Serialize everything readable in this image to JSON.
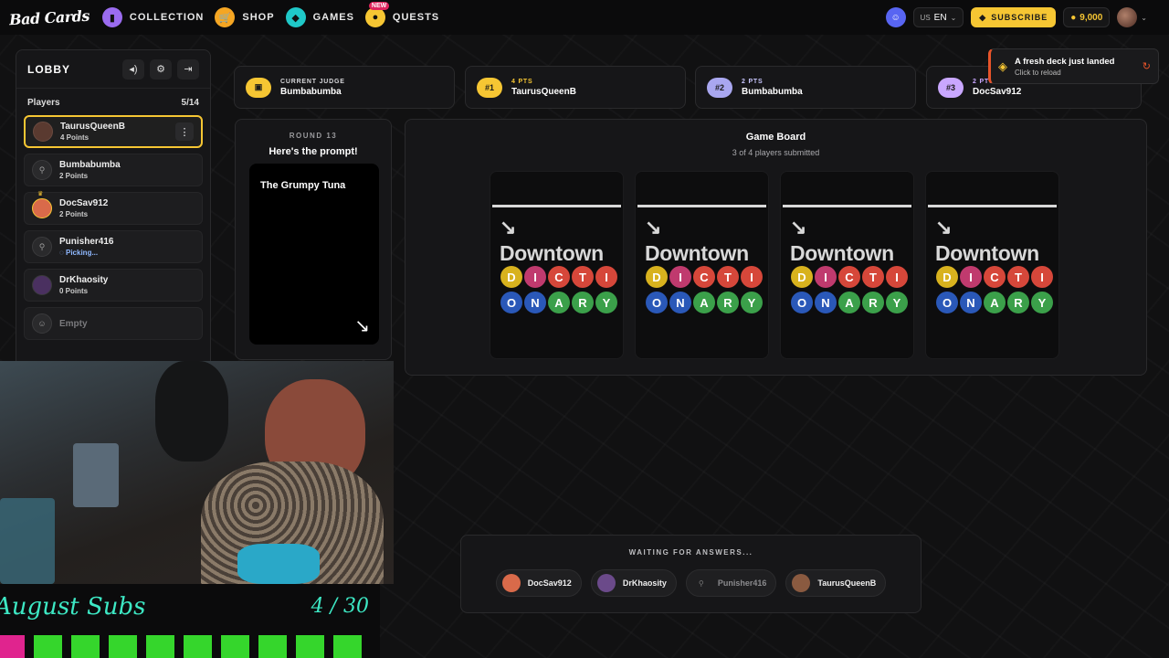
{
  "nav": {
    "logo": "Bad Cards",
    "items": [
      {
        "label": "COLLECTION",
        "color": "#9b6cf0",
        "icon": "card-icon"
      },
      {
        "label": "SHOP",
        "color": "#f5a623",
        "icon": "cart-icon"
      },
      {
        "label": "GAMES",
        "color": "#1fc8c8",
        "icon": "games-icon"
      },
      {
        "label": "QUESTS",
        "color": "#f6c633",
        "icon": "quests-icon",
        "badge": "NEW"
      }
    ],
    "lang_country": "US",
    "lang_code": "EN",
    "subscribe_label": "SUBSCRIBE",
    "coins": "9,000"
  },
  "lobby": {
    "title": "LOBBY",
    "players_label": "Players",
    "players_count": "5/14",
    "players": [
      {
        "name": "TaurusQueenB",
        "points": "4 Points",
        "active": true
      },
      {
        "name": "Bumbabumba",
        "points": "2 Points"
      },
      {
        "name": "DocSav912",
        "points": "2 Points",
        "crown": true
      },
      {
        "name": "Punisher416",
        "status": "Picking..."
      },
      {
        "name": "DrKhaosity",
        "points": "0 Points"
      }
    ],
    "empty_label": "Empty"
  },
  "scoreboard": [
    {
      "badge": "",
      "sub": "CURRENT JUDGE",
      "name": "Bumbabumba",
      "color": "#f6c633",
      "sub_color": "#d7d7da"
    },
    {
      "badge": "#1",
      "sub": "4 PTS",
      "name": "TaurusQueenB",
      "color": "#f6c633",
      "sub_color": "#f6c633"
    },
    {
      "badge": "#2",
      "sub": "2 PTS",
      "name": "Bumbabumba",
      "color": "#a9a7f0",
      "sub_color": "#c9c7ff"
    },
    {
      "badge": "#3",
      "sub": "2 PTS",
      "name": "DocSav912",
      "color": "#b58bf0",
      "sub_color": "#c9a7ff"
    }
  ],
  "toast": {
    "title": "A fresh deck just landed",
    "subtitle": "Click to reload"
  },
  "prompt": {
    "round": "ROUND 13",
    "title": "Here's the prompt!",
    "text": "The Grumpy Tuna"
  },
  "board": {
    "title": "Game Board",
    "subtitle": "3 of 4 players submitted",
    "card_brand": "Downtown",
    "card_row1": [
      "D",
      "I",
      "C",
      "T",
      "I"
    ],
    "card_row2": [
      "O",
      "N",
      "A",
      "R",
      "Y"
    ],
    "row1_colors": [
      "#d8b21e",
      "#c03a6e",
      "#d6473a",
      "#d6473a",
      "#d6473a"
    ],
    "row2_colors": [
      "#2a58b8",
      "#2a58b8",
      "#3ba04a",
      "#3ba04a",
      "#3ba04a"
    ]
  },
  "waiting": {
    "title": "WAITING FOR ANSWERS...",
    "players": [
      {
        "name": "DocSav912",
        "color": "#d96a4a"
      },
      {
        "name": "DrKhaosity",
        "color": "#6b4a8a"
      },
      {
        "name": "Punisher416",
        "color": "#2a2a2c",
        "dim": true
      },
      {
        "name": "TaurusQueenB",
        "color": "#8a5a40"
      }
    ]
  },
  "stream": {
    "subs_title": "August Subs",
    "subs_count": "4 / 30"
  }
}
